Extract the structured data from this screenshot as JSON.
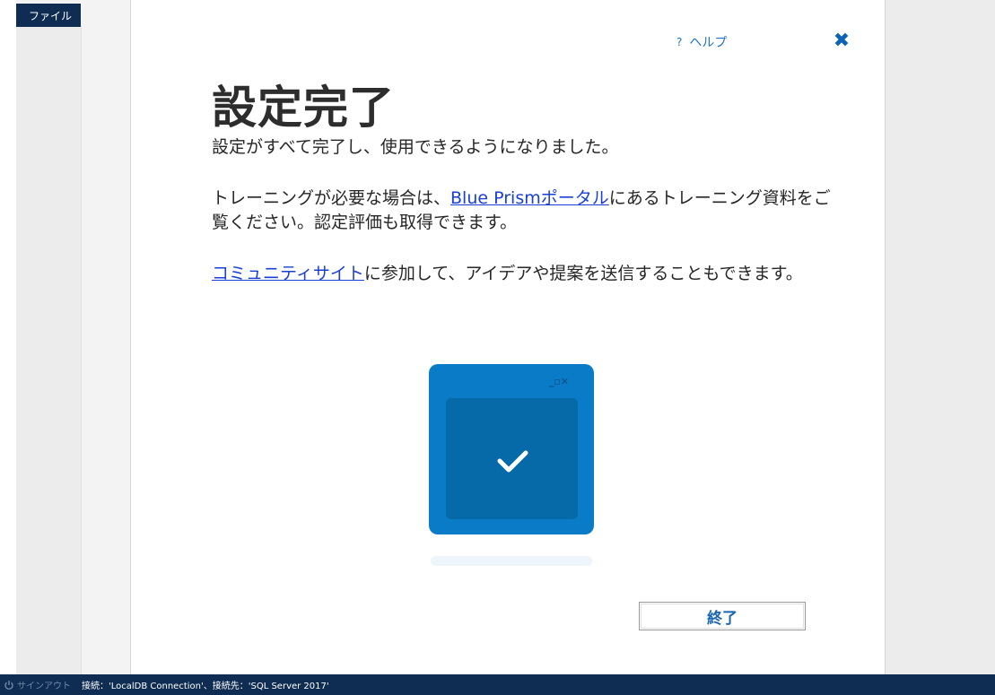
{
  "menu": {
    "file_label": "ファイル"
  },
  "dialog": {
    "help_label": "ヘルプ",
    "help_icon_glyph": "?",
    "close_glyph": "✖",
    "title": "設定完了",
    "paragraph1": "設定がすべて完了し、使用できるようになりました。",
    "paragraph2": {
      "prefix": "トレーニングが必要な場合は、",
      "link": "Blue Prismポータル",
      "suffix": "にあるトレーニング資料をご覧ください。認定評価も取得できます。"
    },
    "paragraph3": {
      "link": "コミュニティサイト",
      "suffix": "に参加して、アイデアや提案を送信することもできます。"
    },
    "finish_label": "終了",
    "illustration_controls": "_▫✕"
  },
  "status_bar": {
    "signout_label": "サインアウト",
    "connection_text": "接続：'LocalDB Connection'、接続先：'SQL Server 2017'"
  },
  "colors": {
    "accent": "#0a7bc6",
    "accent_dark": "#0669a8",
    "status_bg": "#0f2d52",
    "link": "#1a3fd6",
    "button_text": "#1a66b3"
  },
  "icons": {
    "help": "question-icon",
    "close": "close-icon",
    "signout": "power-icon",
    "illustration": "window-check-illustration"
  }
}
